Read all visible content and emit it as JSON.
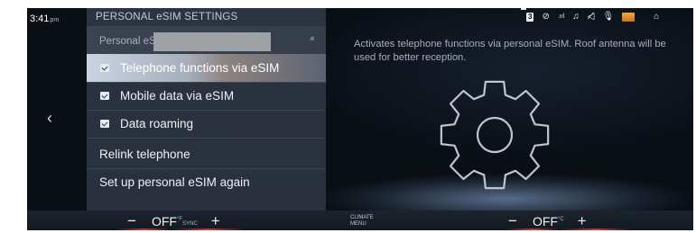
{
  "status_bar": {
    "time": "3:41",
    "ampm": "pm",
    "network_badge": "3",
    "icons": [
      "no-location-icon",
      "signal-icon",
      "music-icon",
      "muted-speaker-icon",
      "microphone-icon",
      "battery-icon",
      "home-icon"
    ]
  },
  "nav": {
    "back_icon": "chevron-left-icon"
  },
  "panel": {
    "title": "PERSONAL eSIM SETTINGS",
    "esim_label": "Personal eSIM (",
    "esim_signal": ".ıııl",
    "items": [
      {
        "label": "Telephone functions via eSIM",
        "checked": true,
        "selected": true
      },
      {
        "label": "Mobile data via eSIM",
        "checked": true,
        "selected": false
      },
      {
        "label": "Data roaming",
        "checked": true,
        "selected": false
      }
    ],
    "actions": [
      {
        "label": "Relink telephone"
      },
      {
        "label": "Set up personal eSIM again"
      }
    ]
  },
  "content": {
    "description": "Activates telephone functions via personal eSIM. Roof antenna will be used for better reception.",
    "illustration": "gear-icon"
  },
  "climate_bar": {
    "left": {
      "minus": "−",
      "value": "OFF",
      "unit": "°F",
      "sync": "SYNC",
      "plus": "+"
    },
    "menu_line1": "CLIMATE",
    "menu_line2": "MENU",
    "right": {
      "minus": "−",
      "value": "OFF",
      "unit": "°C",
      "plus": "+"
    }
  }
}
